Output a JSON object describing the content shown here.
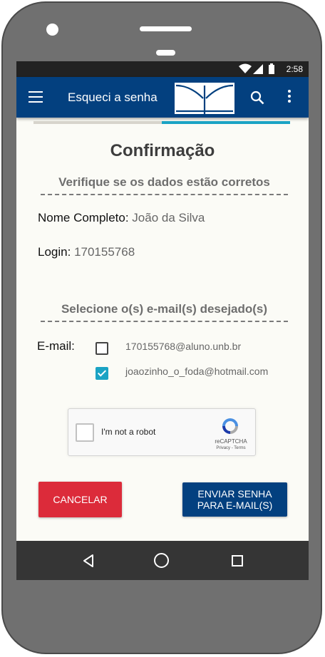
{
  "status": {
    "time": "2:58"
  },
  "appbar": {
    "title": "Esqueci a senha"
  },
  "progress": {
    "fraction": 0.5
  },
  "page": {
    "title": "Confirmação"
  },
  "section1": {
    "title": "Verifique se os dados estão corretos"
  },
  "fields": {
    "name_label": "Nome Completo:",
    "name_value": "João da Silva",
    "login_label": "Login:",
    "login_value": "170155768"
  },
  "section2": {
    "title": "Selecione o(s) e-mail(s) desejado(s)"
  },
  "emails": {
    "label": "E-mail:",
    "items": [
      {
        "address": "170155768@aluno.unb.br",
        "checked": false
      },
      {
        "address": "joaozinho_o_foda@hotmail.com",
        "checked": true
      }
    ]
  },
  "recaptcha": {
    "label": "I'm not a robot",
    "brand": "reCAPTCHA",
    "links": "Privacy - Terms"
  },
  "buttons": {
    "cancel": "CANCELAR",
    "send_line1": "ENVIAR SENHA",
    "send_line2": "PARA E-MAIL(S)"
  },
  "colors": {
    "primary": "#03407f",
    "accent": "#1aa3c4",
    "danger": "#dc2b3a"
  },
  "icons": [
    "menu-icon",
    "search-icon",
    "more-vert-icon",
    "wifi-icon",
    "signal-icon",
    "battery-icon",
    "back-icon",
    "home-icon",
    "recents-icon"
  ]
}
